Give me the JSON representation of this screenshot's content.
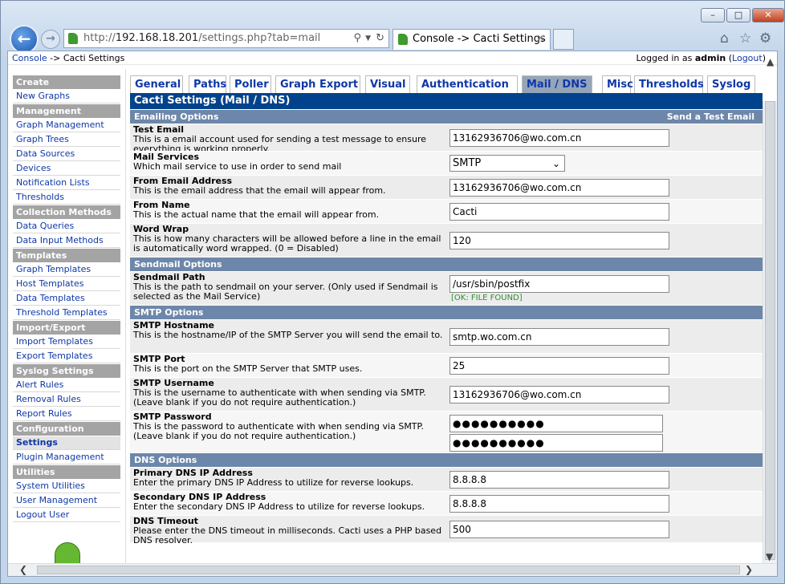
{
  "browser": {
    "address_prefix": "http://",
    "address_host": "192.168.18.201",
    "address_path": "/settings.php?tab=mail",
    "tab_title": "Console -> Cacti Settings",
    "window_buttons": {
      "minimize": "–",
      "maximize": "□",
      "close": "✕"
    },
    "icons": {
      "back": "back-arrow-icon",
      "forward": "forward-arrow-icon",
      "home": "home-icon",
      "favorites": "star-icon",
      "settings": "gear-icon"
    }
  },
  "breadcrumb": {
    "console": "Console",
    "current": " -> Cacti Settings",
    "logged_in_prefix": "Logged in as ",
    "user": "admin",
    "logout_open": " (",
    "logout": "Logout",
    "logout_close": ")"
  },
  "sidebar": [
    {
      "type": "header",
      "label": "Create"
    },
    {
      "type": "item",
      "label": "New Graphs"
    },
    {
      "type": "header",
      "label": "Management"
    },
    {
      "type": "item",
      "label": "Graph Management"
    },
    {
      "type": "item",
      "label": "Graph Trees"
    },
    {
      "type": "item",
      "label": "Data Sources"
    },
    {
      "type": "item",
      "label": "Devices"
    },
    {
      "type": "item",
      "label": "Notification Lists"
    },
    {
      "type": "item",
      "label": "Thresholds"
    },
    {
      "type": "header",
      "label": "Collection Methods"
    },
    {
      "type": "item",
      "label": "Data Queries"
    },
    {
      "type": "item",
      "label": "Data Input Methods"
    },
    {
      "type": "header",
      "label": "Templates"
    },
    {
      "type": "item",
      "label": "Graph Templates"
    },
    {
      "type": "item",
      "label": "Host Templates"
    },
    {
      "type": "item",
      "label": "Data Templates"
    },
    {
      "type": "item",
      "label": "Threshold Templates"
    },
    {
      "type": "header",
      "label": "Import/Export"
    },
    {
      "type": "item",
      "label": "Import Templates"
    },
    {
      "type": "item",
      "label": "Export Templates"
    },
    {
      "type": "header",
      "label": "Syslog Settings"
    },
    {
      "type": "item",
      "label": "Alert Rules"
    },
    {
      "type": "item",
      "label": "Removal Rules"
    },
    {
      "type": "item",
      "label": "Report Rules"
    },
    {
      "type": "header",
      "label": "Configuration"
    },
    {
      "type": "item",
      "label": "Settings",
      "active": true
    },
    {
      "type": "item",
      "label": "Plugin Management"
    },
    {
      "type": "header",
      "label": "Utilities"
    },
    {
      "type": "item",
      "label": "System Utilities"
    },
    {
      "type": "item",
      "label": "User Management"
    },
    {
      "type": "item",
      "label": "Logout User"
    }
  ],
  "tabs": [
    {
      "label": "General"
    },
    {
      "label": "Paths"
    },
    {
      "label": "Poller"
    },
    {
      "label": "Graph Export"
    },
    {
      "label": "Visual"
    },
    {
      "label": "Authentication"
    },
    {
      "label": "Mail / DNS",
      "active": true
    },
    {
      "label": "Misc"
    },
    {
      "label": "Thresholds"
    },
    {
      "label": "Syslog"
    }
  ],
  "page_title": "Cacti Settings (Mail / DNS)",
  "send_test": "Send a Test Email",
  "sections": [
    {
      "type": "section",
      "label": "Emailing Options"
    },
    {
      "type": "row",
      "label": "Test Email",
      "desc": "This is a email account used for sending a test message to ensure everything is working properly.",
      "field": "text",
      "value": "13162936706@wo.com.cn"
    },
    {
      "type": "row",
      "label": "Mail Services",
      "desc": "Which mail service to use in order to send mail",
      "field": "select",
      "value": "SMTP"
    },
    {
      "type": "row",
      "label": "From Email Address",
      "desc": "This is the email address that the email will appear from.",
      "field": "text",
      "value": "13162936706@wo.com.cn"
    },
    {
      "type": "row",
      "label": "From Name",
      "desc": "This is the actual name that the email will appear from.",
      "field": "text",
      "value": "Cacti"
    },
    {
      "type": "row",
      "label": "Word Wrap",
      "desc": "This is how many characters will be allowed before a line in the email is automatically word wrapped. (0 = Disabled)",
      "field": "text",
      "value": "120"
    },
    {
      "type": "section",
      "label": "Sendmail Options"
    },
    {
      "type": "row",
      "label": "Sendmail Path",
      "desc": "This is the path to sendmail on your server. (Only used if Sendmail is selected as the Mail Service)",
      "field": "text",
      "value": "/usr/sbin/postfix",
      "status": "[OK: FILE FOUND]"
    },
    {
      "type": "section",
      "label": "SMTP Options"
    },
    {
      "type": "row",
      "label": "SMTP Hostname",
      "desc": "This is the hostname/IP of the SMTP Server you will send the email to.",
      "field": "text",
      "value": "smtp.wo.com.cn"
    },
    {
      "type": "row",
      "label": "SMTP Port",
      "desc": "This is the port on the SMTP Server that SMTP uses.",
      "field": "text",
      "value": "25"
    },
    {
      "type": "row",
      "label": "SMTP Username",
      "desc": "This is the username to authenticate with when sending via SMTP. (Leave blank if you do not require authentication.)",
      "field": "text",
      "value": "13162936706@wo.com.cn"
    },
    {
      "type": "row",
      "label": "SMTP Password",
      "desc": "This is the password to authenticate with when sending via SMTP. (Leave blank if you do not require authentication.)",
      "field": "password",
      "value": "●●●●●●●●●●",
      "confirm": "●●●●●●●●●●"
    },
    {
      "type": "section",
      "label": "DNS Options"
    },
    {
      "type": "row",
      "label": "Primary DNS IP Address",
      "desc": "Enter the primary DNS IP Address to utilize for reverse lookups.",
      "field": "text",
      "value": "8.8.8.8"
    },
    {
      "type": "row",
      "label": "Secondary DNS IP Address",
      "desc": "Enter the secondary DNS IP Address to utilize for reverse lookups.",
      "field": "text",
      "value": "8.8.8.8"
    },
    {
      "type": "row",
      "label": "DNS Timeout",
      "desc": "Please enter the DNS timeout in milliseconds. Cacti uses a PHP based DNS resolver.",
      "field": "text",
      "value": "500"
    }
  ]
}
